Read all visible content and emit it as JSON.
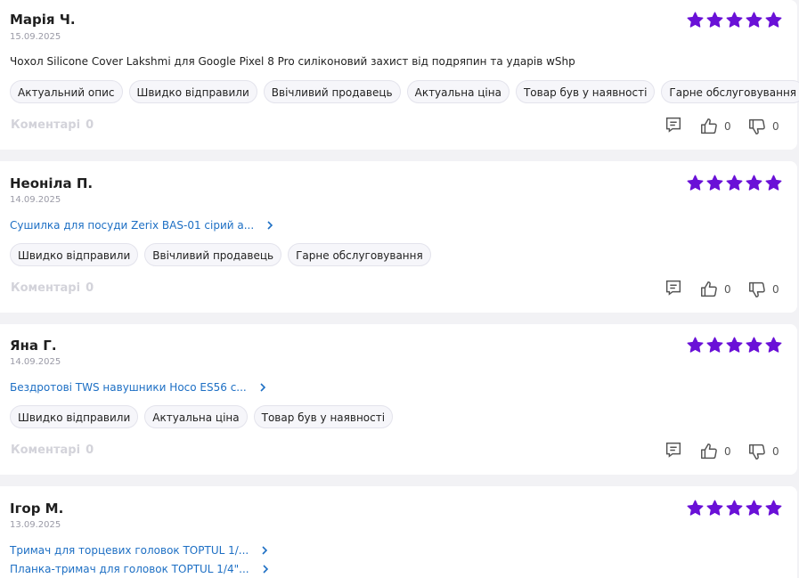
{
  "colors": {
    "star": "#6a11d7",
    "link": "#1d6fc4",
    "comments": "#d3d3da"
  },
  "reviews": [
    {
      "author": "Марія Ч.",
      "date": "15.09.2025",
      "rating": 5,
      "products": [
        {
          "text": "Чохол Silicone Cover Lakshmi для Google Pixel 8 Pro силіконовий захист від подряпин та ударів wShp",
          "link": false
        }
      ],
      "tags": [
        "Актуальний опис",
        "Швидко відправили",
        "Ввічливий продавець",
        "Актуальна ціна",
        "Товар був у наявності",
        "Гарне обслуговування"
      ],
      "comments_label": "Коментарі",
      "comments_count": "0",
      "likes": "0",
      "dislikes": "0"
    },
    {
      "author": "Неоніла П.",
      "date": "14.09.2025",
      "rating": 5,
      "products": [
        {
          "text": "Сушилка для посуди Zerix BAS-01 сірий а...",
          "link": true
        }
      ],
      "tags": [
        "Швидко відправили",
        "Ввічливий продавець",
        "Гарне обслуговування"
      ],
      "comments_label": "Коментарі",
      "comments_count": "0",
      "likes": "0",
      "dislikes": "0"
    },
    {
      "author": "Яна Г.",
      "date": "14.09.2025",
      "rating": 5,
      "products": [
        {
          "text": "Бездротові TWS навушники Hoco ES56 с...",
          "link": true
        }
      ],
      "tags": [
        "Швидко відправили",
        "Актуальна ціна",
        "Товар був у наявності"
      ],
      "comments_label": "Коментарі",
      "comments_count": "0",
      "likes": "0",
      "dislikes": "0"
    },
    {
      "author": "Ігор М.",
      "date": "13.09.2025",
      "rating": 5,
      "products": [
        {
          "text": "Тримач для торцевих головок TOPTUL 1/...",
          "link": true
        },
        {
          "text": "Планка-тримач для головок TOPTUL 1/4\"...",
          "link": true
        }
      ],
      "tags": [],
      "comments_label": "",
      "comments_count": "",
      "likes": "",
      "dislikes": ""
    }
  ]
}
